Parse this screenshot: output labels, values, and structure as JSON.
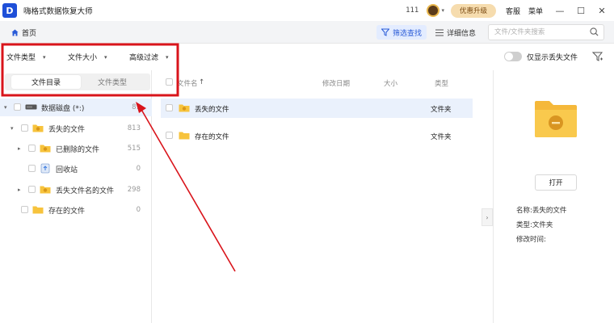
{
  "app": {
    "logo_letter": "D",
    "title": "嗨格式数据恢复大师"
  },
  "titlebar": {
    "count": "111",
    "promo_label": "优惠升级",
    "service_label": "客服",
    "menu_label": "菜单",
    "minimize": "—",
    "maximize": "☐",
    "close": "✕"
  },
  "toolbar": {
    "home_label": "首页",
    "filter_label": "筛选查找",
    "detail_label": "详细信息",
    "search_placeholder": "文件/文件夹搜索"
  },
  "filters": {
    "file_type": "文件类型",
    "file_size": "文件大小",
    "advanced": "高级过滤",
    "only_lost_label": "仅显示丢失文件",
    "only_lost_on": false
  },
  "left": {
    "tab_dir": "文件目录",
    "tab_type": "文件类型",
    "tree": [
      {
        "label": "数据磁盘 (*:)",
        "count": "81"
      },
      {
        "label": "丢失的文件",
        "count": "813"
      },
      {
        "label": "已删除的文件",
        "count": "515"
      },
      {
        "label": "回收站",
        "count": "0"
      },
      {
        "label": "丢失文件名的文件",
        "count": "298"
      },
      {
        "label": "存在的文件",
        "count": "0"
      }
    ]
  },
  "list": {
    "columns": {
      "name": "文件名",
      "sort": "↑",
      "date": "修改日期",
      "size": "大小",
      "type": "类型"
    },
    "rows": [
      {
        "name": "丢失的文件",
        "type": "文件夹"
      },
      {
        "name": "存在的文件",
        "type": "文件夹"
      }
    ]
  },
  "detail": {
    "open_label": "打开",
    "name_line": "名称:丢失的文件",
    "type_line": "类型:文件夹",
    "date_line": "修改时间:"
  },
  "colors": {
    "accent": "#2a5bd7",
    "annotation_red": "#d9141b",
    "folder_yellow": "#f7c33c",
    "selection": "#eaf1fc"
  }
}
